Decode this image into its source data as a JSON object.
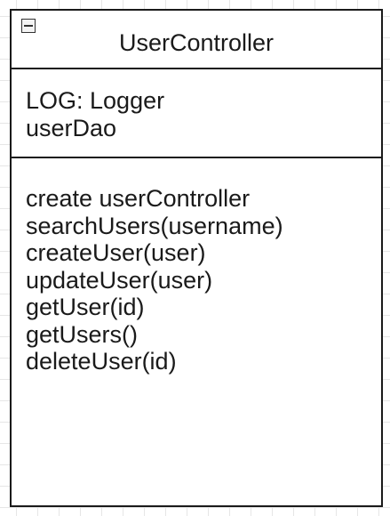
{
  "uml_class": {
    "name": "UserController",
    "attributes": [
      "LOG: Logger",
      "userDao"
    ],
    "methods": [
      "create userController",
      "searchUsers(username)",
      "createUser(user)",
      "updateUser(user)",
      "getUser(id)",
      "getUsers()",
      "deleteUser(id)"
    ]
  },
  "colors": {
    "border": "#1a1a1a",
    "grid": "#e6e6e6",
    "background": "#ffffff"
  },
  "icons": {
    "collapse": "minus-box-icon"
  }
}
